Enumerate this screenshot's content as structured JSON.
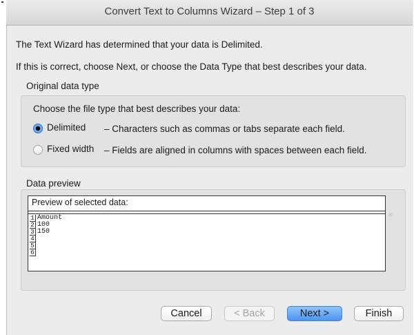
{
  "window": {
    "title": "Convert Text to Columns Wizard – Step 1 of 3"
  },
  "intro": {
    "line1": "The Text Wizard has determined that your data is Delimited.",
    "line2": "If this is correct, choose Next, or choose the Data Type that best describes your data."
  },
  "original_type": {
    "label": "Original data type",
    "prompt": "Choose the file type that best describes your data:",
    "options": [
      {
        "label": "Delimited",
        "description": "– Characters such as commas or tabs separate each field.",
        "selected": true
      },
      {
        "label": "Fixed width",
        "description": "– Fields are aligned in columns with spaces between each field.",
        "selected": false
      }
    ]
  },
  "preview": {
    "label": "Data preview",
    "title": "Preview of selected data:",
    "rows": [
      {
        "num": "1",
        "value": "Amount"
      },
      {
        "num": "2",
        "value": "100"
      },
      {
        "num": "3",
        "value": "150"
      },
      {
        "num": "4",
        "value": ""
      },
      {
        "num": "5",
        "value": ""
      },
      {
        "num": "6",
        "value": ""
      }
    ]
  },
  "buttons": {
    "cancel": "Cancel",
    "back": "< Back",
    "next": "Next >",
    "finish": "Finish"
  },
  "colors": {
    "accent": "#4b95f0",
    "background": "#ececec"
  }
}
